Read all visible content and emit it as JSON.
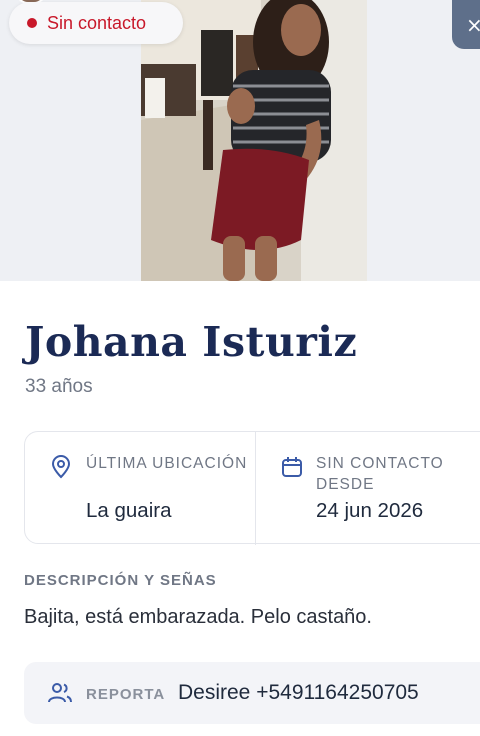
{
  "status": {
    "label": "Sin contacto",
    "color": "#c8182a"
  },
  "close": {
    "icon": "close-icon",
    "label": "×"
  },
  "person": {
    "name": "Johana Isturiz",
    "age": "33 años"
  },
  "info": {
    "last_location": {
      "icon": "map-pin-icon",
      "label": "Última ubicación",
      "value": "La guaira"
    },
    "no_contact_since": {
      "icon": "calendar-icon",
      "label": "Sin contacto desde",
      "value": "24 jun 2026"
    }
  },
  "description": {
    "heading": "Descripción y señas",
    "text": "Bajita, está embarazada. Pelo castaño."
  },
  "report": {
    "icon": "users-icon",
    "label": "Reporta",
    "value": "Desiree +5491164250705"
  },
  "colors": {
    "accent_navy": "#1b2a55",
    "icon_blue": "#3b5ba8",
    "muted_text": "#707785",
    "alert_red": "#c8182a",
    "close_button": "#5e6f8a"
  }
}
